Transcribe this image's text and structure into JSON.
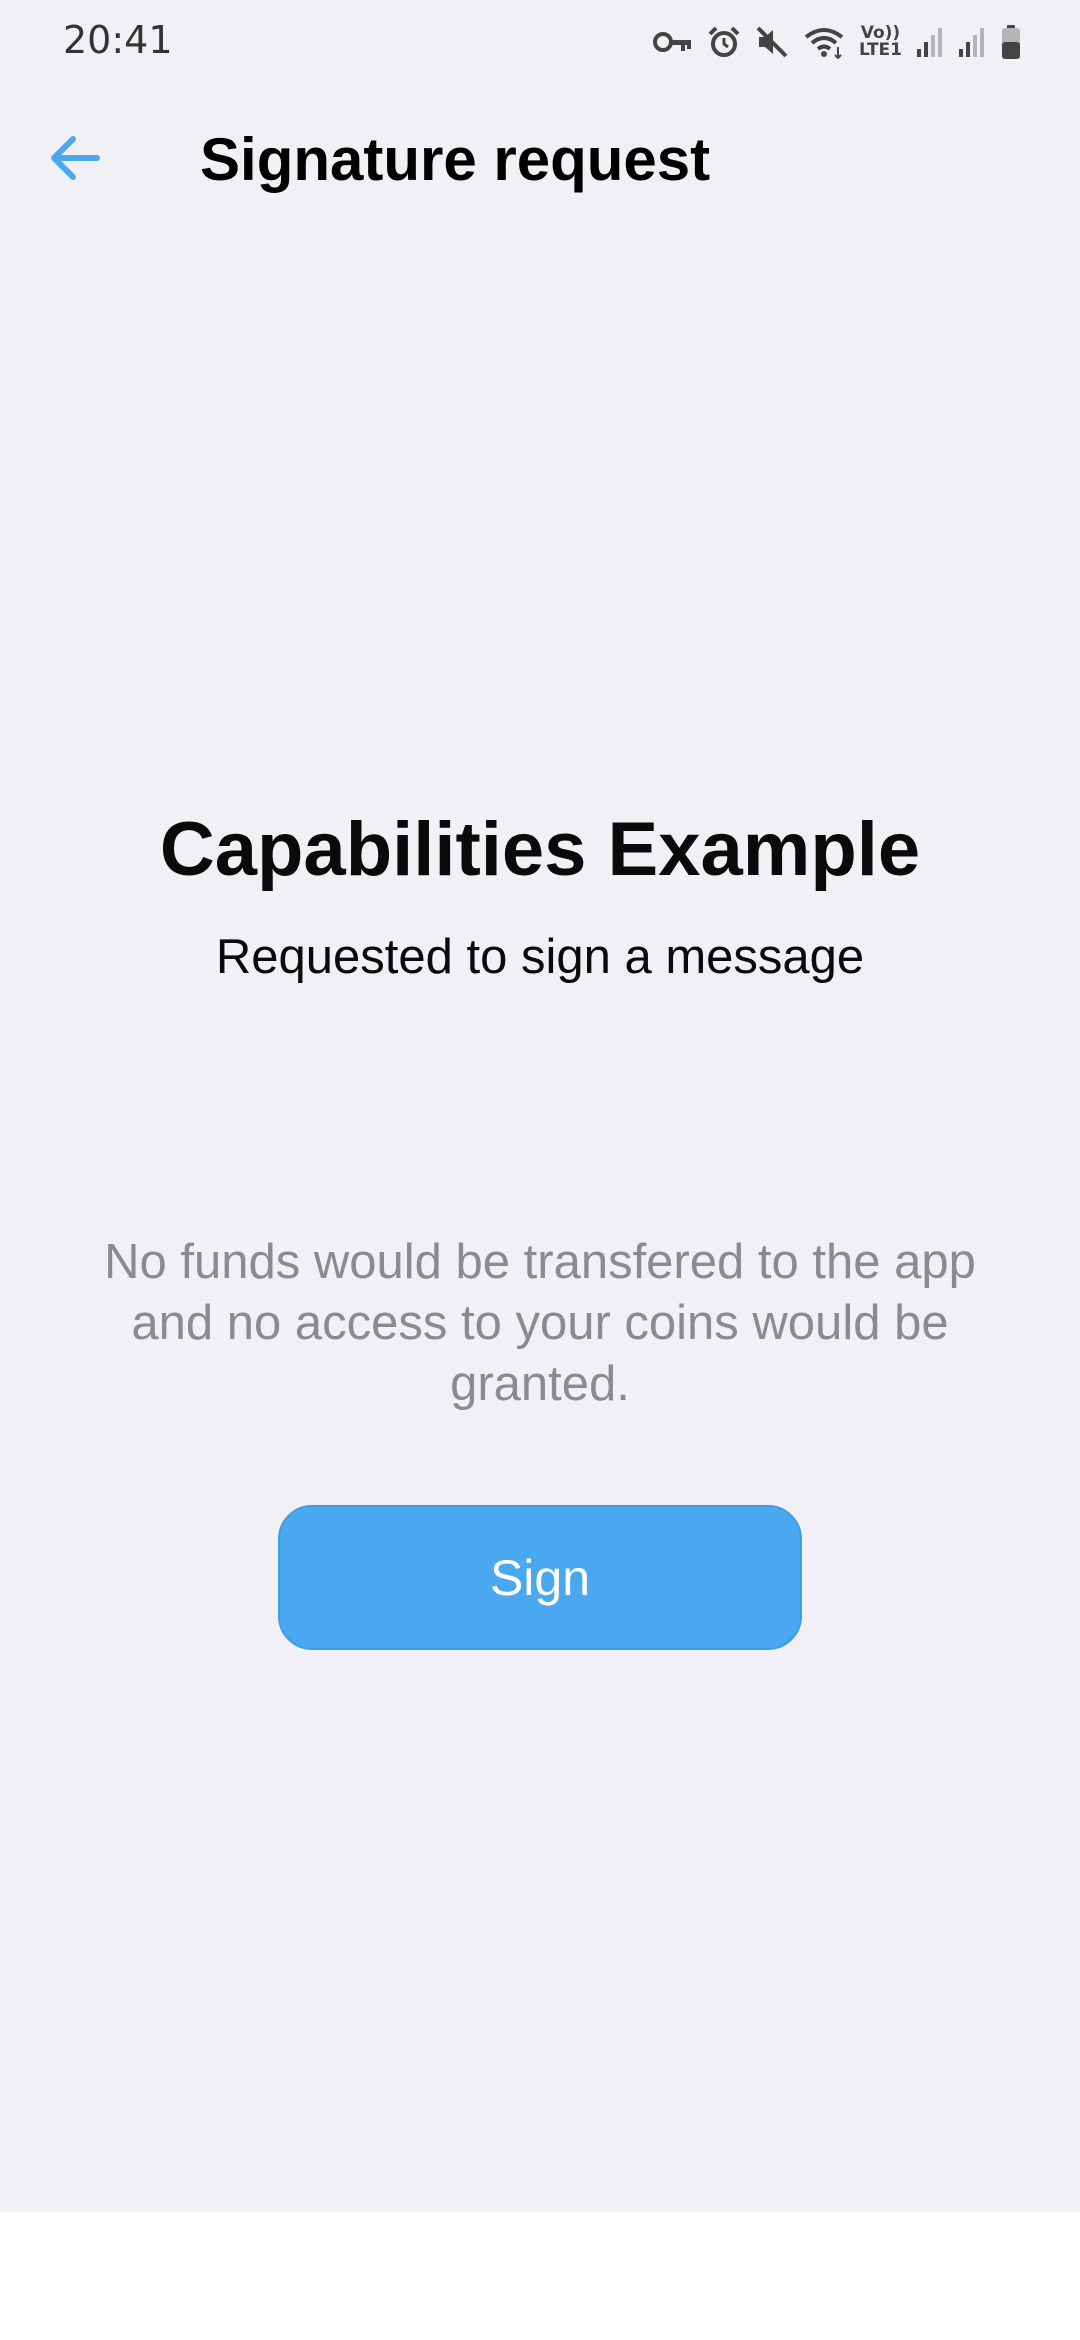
{
  "status_bar": {
    "time": "20:41",
    "network_label_top": "Vo))",
    "network_label_bottom": "LTE1",
    "icons": [
      "vpn-key-icon",
      "alarm-icon",
      "mute-icon",
      "wifi-icon",
      "signal-icon",
      "signal-icon",
      "battery-icon"
    ]
  },
  "app_bar": {
    "back_icon": "arrow-left-icon",
    "title": "Signature request"
  },
  "content": {
    "app_name": "Capabilities Example",
    "subtitle": "Requested to sign a message",
    "disclaimer": "No funds would be transfered to the app and no access to your coins would be granted.",
    "sign_label": "Sign"
  },
  "colors": {
    "background": "#f0f0f5",
    "accent": "#4aa8f0",
    "muted_text": "#8a8a90"
  }
}
